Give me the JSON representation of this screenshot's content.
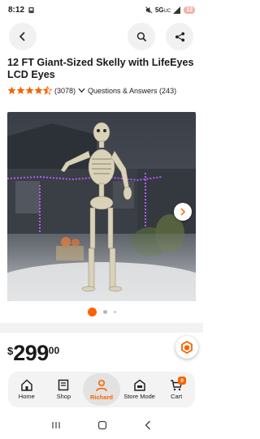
{
  "status_bar": {
    "time": "8:12",
    "network": "5G",
    "network_sub": "UC",
    "battery": "12"
  },
  "product": {
    "title": "12 FT Giant-Sized Skelly with LifeEyes LCD Eyes",
    "rating": 4.5,
    "review_count": "(3078)",
    "qa_text": "Questions & Answers (243)"
  },
  "gallery": {
    "image_count": 3,
    "active_index": 0
  },
  "price": {
    "currency": "$",
    "dollars": "299",
    "cents": "00"
  },
  "bottom_nav": {
    "items": [
      {
        "label": "Home",
        "icon": "house-icon"
      },
      {
        "label": "Shop",
        "icon": "shop-icon"
      },
      {
        "label": "Richard",
        "icon": "person-icon",
        "active": true
      },
      {
        "label": "Store Mode",
        "icon": "store-icon"
      },
      {
        "label": "Cart",
        "icon": "cart-icon",
        "badge": "0"
      }
    ]
  },
  "colors": {
    "accent": "#f96302",
    "star": "#f96302",
    "text": "#1a1a1a"
  }
}
